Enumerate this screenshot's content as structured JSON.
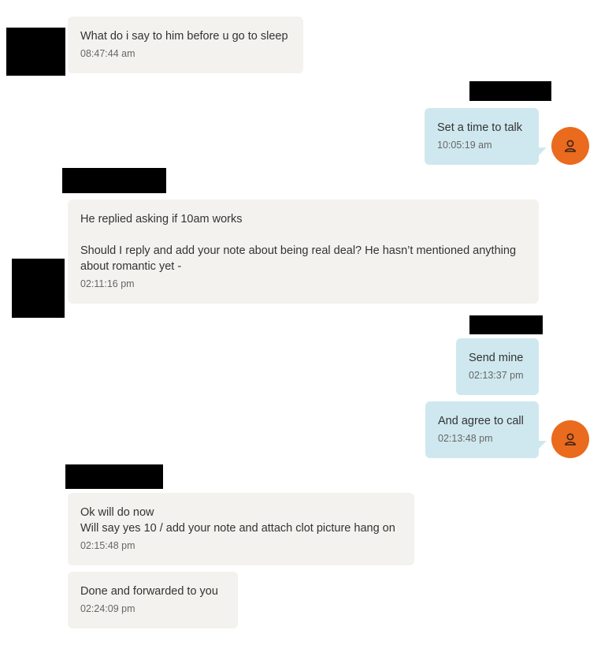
{
  "messages": [
    {
      "direction": "incoming",
      "lines": [
        "What do i say to him before u go to sleep"
      ],
      "time": "08:47:44 am"
    },
    {
      "direction": "outgoing",
      "lines": [
        "Set a time to talk"
      ],
      "time": "10:05:19 am"
    },
    {
      "direction": "incoming",
      "lines": [
        "He replied asking if 10am works",
        "",
        "Should I reply and add your note about being real deal? He hasn’t mentioned anything",
        "about romantic yet -"
      ],
      "time": "02:11:16 pm"
    },
    {
      "direction": "outgoing",
      "lines": [
        "Send mine"
      ],
      "time": "02:13:37 pm"
    },
    {
      "direction": "outgoing",
      "lines": [
        "And agree to call"
      ],
      "time": "02:13:48 pm"
    },
    {
      "direction": "incoming",
      "lines": [
        "Ok will do now",
        "Will say yes 10 / add your note and attach clot picture hang on"
      ],
      "time": "02:15:48 pm"
    },
    {
      "direction": "incoming",
      "lines": [
        "Done and forwarded to you"
      ],
      "time": "02:24:09 pm"
    }
  ],
  "colors": {
    "incoming_bubble": "#f4f2ef",
    "outgoing_bubble": "#cfe8ef",
    "avatar": "#ea6a1e",
    "redaction": "#000000"
  },
  "icons": {
    "avatar": "person-icon"
  }
}
